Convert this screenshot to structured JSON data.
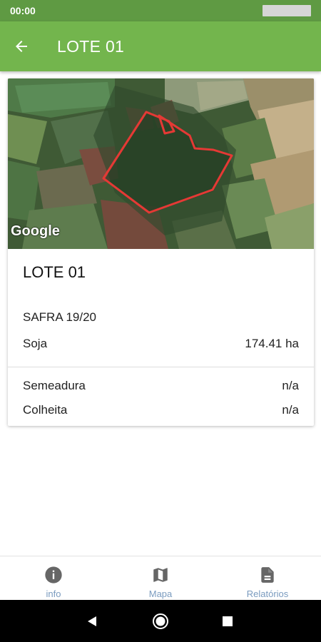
{
  "status_bar": {
    "time": "00:00"
  },
  "app_bar": {
    "title": "LOTE 01"
  },
  "card": {
    "map_attribution": "Google",
    "title": "LOTE 01",
    "season": "SAFRA 19/20",
    "crop": {
      "label": "Soja",
      "value": "174.41 ha"
    },
    "sowing": {
      "label": "Semeadura",
      "value": "n/a"
    },
    "harvest": {
      "label": "Colheita",
      "value": "n/a"
    }
  },
  "bottom_nav": {
    "items": [
      {
        "label": "info",
        "icon": "info-icon"
      },
      {
        "label": "Mapa",
        "icon": "map-icon"
      },
      {
        "label": "Relatórios",
        "icon": "report-icon"
      }
    ]
  },
  "colors": {
    "status_bar": "#5f9a43",
    "app_bar": "#73b54d",
    "field_outline": "#e53935",
    "nav_label": "#7a9bbf",
    "nav_icon": "#666666"
  }
}
